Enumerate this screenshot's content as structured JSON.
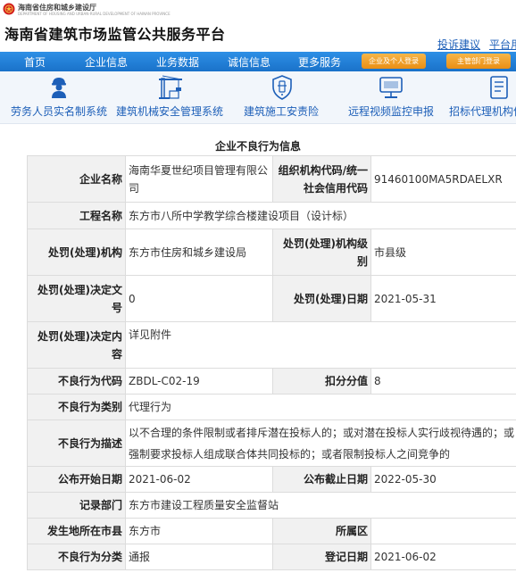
{
  "header": {
    "department": "海南省住房和城乡建设厅",
    "department_en": "DEPARTMENT OF HOUSING AND URBAN-RURAL DEVELOPMENT OF HAINAN PROVINCE",
    "site_title": "海南省建筑市场监管公共服务平台",
    "links": [
      "投诉建议",
      "平台用"
    ]
  },
  "nav": {
    "items": [
      "首页",
      "企业信息",
      "业务数据",
      "诚信信息",
      "更多服务"
    ],
    "login_buttons": [
      "企业及个人登录",
      "主管部门登录"
    ]
  },
  "systems": [
    "劳务人员实名制系统",
    "建筑机械安全管理系统",
    "建筑施工安责险",
    "远程视频监控申报",
    "招标代理机构信"
  ],
  "section_title": "企业不良行为信息",
  "record": {
    "company_name_label": "企业名称",
    "company_name": "海南华夏世纪项目管理有限公司",
    "org_code_label": "组织机构代码/统一社会信用代码",
    "org_code": "91460100MA5RDAELXR",
    "project_label": "工程名称",
    "project": "东方市八所中学教学综合楼建设项目（设计标）",
    "agency_label": "处罚(处理)机构",
    "agency": "东方市住房和城乡建设局",
    "agency_level_label": "处罚(处理)机构级别",
    "agency_level": "市县级",
    "decision_no_label": "处罚(处理)决定文号",
    "decision_no": "0",
    "decision_date_label": "处罚(处理)日期",
    "decision_date": "2021-05-31",
    "decision_content_label": "处罚(处理)决定内容",
    "decision_content": "详见附件",
    "behavior_code_label": "不良行为代码",
    "behavior_code": "ZBDL-C02-19",
    "score_label": "扣分分值",
    "score": "8",
    "category_label": "不良行为类别",
    "category": "代理行为",
    "description_label": "不良行为描述",
    "description": "以不合理的条件限制或者排斥潜在投标人的；或对潜在投标人实行歧视待遇的；或强制要求投标人组成联合体共同投标的；或者限制投标人之间竞争的",
    "publish_start_label": "公布开始日期",
    "publish_start": "2021-06-02",
    "publish_end_label": "公布截止日期",
    "publish_end": "2022-05-30",
    "record_dept_label": "记录部门",
    "record_dept": "东方市建设工程质量安全监督站",
    "city_label": "发生地所在市县",
    "city": "东方市",
    "district_label": "所属区",
    "district": "",
    "classification_label": "不良行为分类",
    "classification": "通报",
    "register_date_label": "登记日期",
    "register_date": "2021-06-02"
  },
  "colors": {
    "nav_blue": "#1a72c9",
    "link_blue": "#1d5fb8",
    "login_orange": "#e98e14",
    "label_bg": "#f1f1f1"
  }
}
